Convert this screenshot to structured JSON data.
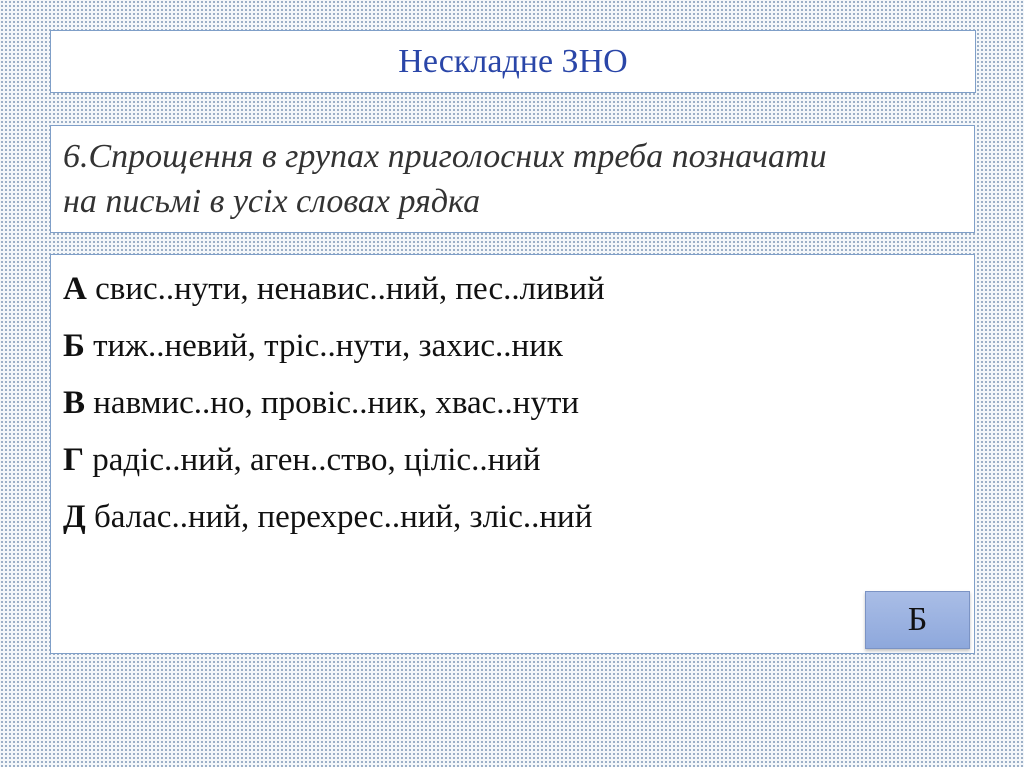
{
  "title": "Нескладне ЗНО",
  "question": {
    "line1": "6.Спрощення в групах приголосних треба позначати",
    "line2": "на письмі в усіх словах рядка"
  },
  "options": [
    {
      "letter": "А",
      "text": "свис..нути, ненавис..ний, пес..ливий"
    },
    {
      "letter": "Б",
      "text": "тиж..невий, тріс..нути, захис..ник"
    },
    {
      "letter": "В",
      "text": "навмис..но, провіс..ник, хвас..нути"
    },
    {
      "letter": "Г",
      "text": "радіс..ний, аген..ство, ціліс..ний"
    },
    {
      "letter": "Д",
      "text": "балас..ний, перехрес..ний, зліс..ний"
    }
  ],
  "answer": "Б",
  "colors": {
    "title": "#2a46a8",
    "border": "#7f9fc8",
    "button": "#9db3e2"
  }
}
